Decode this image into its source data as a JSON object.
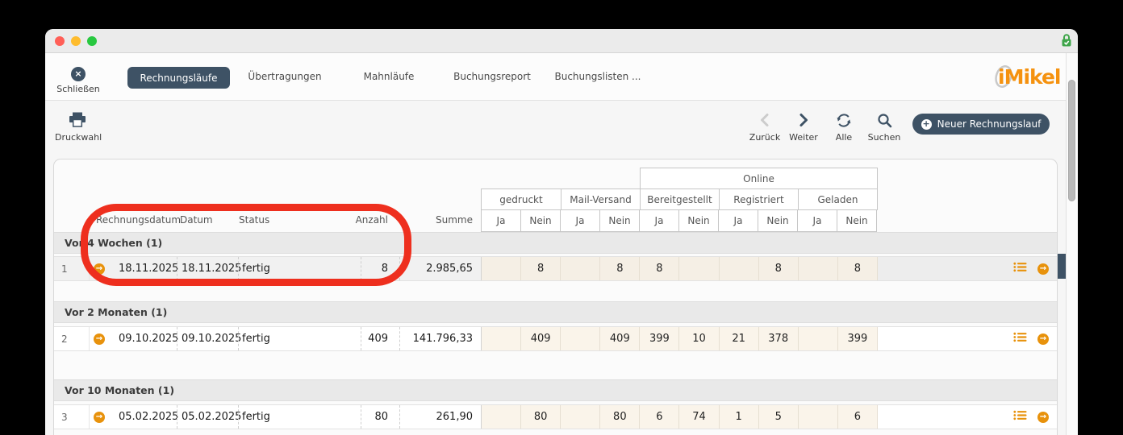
{
  "colors": {
    "accent_dark": "#3e5265",
    "accent_orange": "#e8920c",
    "logo_orange": "#f5920f",
    "annotation_red": "#ee2f1e",
    "jn_cell_cream": "#faf4ea",
    "group_header_bg": "#e9e9e9",
    "lock_green": "#3fa54a",
    "traffic_red": "#ff5f57",
    "traffic_yellow": "#febc2e",
    "traffic_green": "#28c840"
  },
  "toolbar": {
    "close_label": "Schließen",
    "tabs": [
      "Rechnungsläufe",
      "Übertragungen",
      "Mahnläufe",
      "Buchungsreport",
      "Buchungslisten ..."
    ],
    "logo_text": "iMikel"
  },
  "actionbar": {
    "print_label": "Druckwahl",
    "back_label": "Zurück",
    "next_label": "Weiter",
    "all_label": "Alle",
    "search_label": "Suchen",
    "new_run_label": "Neuer Rechnungslauf"
  },
  "table": {
    "header": {
      "rechnungsdatum": "Rechnungsdatum",
      "datum": "Datum",
      "status": "Status",
      "anzahl": "Anzahl",
      "summe": "Summe",
      "online": "Online",
      "gedruckt": "gedruckt",
      "mail_versand": "Mail-Versand",
      "bereitgestellt": "Bereitgestellt",
      "registriert": "Registriert",
      "geladen": "Geladen",
      "ja": "Ja",
      "nein": "Nein"
    },
    "groups": [
      {
        "label": "Vor 4 Wochen (1)",
        "rows": [
          {
            "index": "1",
            "rechnungsdatum": "18.11.2025",
            "datum": "18.11.2025",
            "status": "fertig",
            "anzahl": "8",
            "summe": "2.985,65",
            "gedruckt_ja": "",
            "gedruckt_nein": "8",
            "mail_ja": "",
            "mail_nein": "8",
            "bereitgestellt_ja": "8",
            "bereitgestellt_nein": "",
            "registriert_ja": "",
            "registriert_nein": "8",
            "geladen_ja": "",
            "geladen_nein": "8",
            "selected": true
          }
        ]
      },
      {
        "label": "Vor 2 Monaten (1)",
        "rows": [
          {
            "index": "2",
            "rechnungsdatum": "09.10.2025",
            "datum": "09.10.2025",
            "status": "fertig",
            "anzahl": "409",
            "summe": "141.796,33",
            "gedruckt_ja": "",
            "gedruckt_nein": "409",
            "mail_ja": "",
            "mail_nein": "409",
            "bereitgestellt_ja": "399",
            "bereitgestellt_nein": "10",
            "registriert_ja": "21",
            "registriert_nein": "378",
            "geladen_ja": "",
            "geladen_nein": "399",
            "selected": false
          }
        ]
      },
      {
        "label": "Vor 10 Monaten (1)",
        "rows": [
          {
            "index": "3",
            "rechnungsdatum": "05.02.2025",
            "datum": "05.02.2025",
            "status": "fertig",
            "anzahl": "80",
            "summe": "261,90",
            "gedruckt_ja": "",
            "gedruckt_nein": "80",
            "mail_ja": "",
            "mail_nein": "80",
            "bereitgestellt_ja": "6",
            "bereitgestellt_nein": "74",
            "registriert_ja": "1",
            "registriert_nein": "5",
            "geladen_ja": "",
            "geladen_nein": "6",
            "selected": false
          }
        ]
      }
    ]
  }
}
